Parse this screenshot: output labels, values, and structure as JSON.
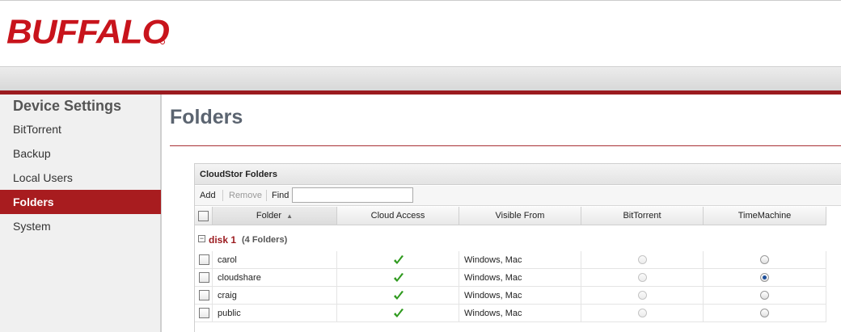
{
  "header": {
    "logo_text": "BUFFALO",
    "brand_color": "#c8141c"
  },
  "sidebar": {
    "title": "Device Settings",
    "items": [
      {
        "label": "BitTorrent",
        "active": false
      },
      {
        "label": "Backup",
        "active": false
      },
      {
        "label": "Local Users",
        "active": false
      },
      {
        "label": "Folders",
        "active": true
      },
      {
        "label": "System",
        "active": false
      }
    ]
  },
  "main": {
    "title": "Folders",
    "grid": {
      "caption": "CloudStor Folders",
      "toolbar": {
        "add": "Add",
        "remove": "Remove",
        "find_label": "Find",
        "find_value": ""
      },
      "columns": [
        "Folder",
        "Cloud Access",
        "Visible From",
        "BitTorrent",
        "TimeMachine"
      ],
      "sort_indicator": "▲",
      "group": {
        "name": "disk 1",
        "count": "(4 Folders)"
      },
      "rows": [
        {
          "folder": "carol",
          "cloud_access": "check-icon",
          "visible_from": "Windows, Mac",
          "bittorrent": false,
          "timemachine": false
        },
        {
          "folder": "cloudshare",
          "cloud_access": "check-icon",
          "visible_from": "Windows, Mac",
          "bittorrent": false,
          "timemachine": true
        },
        {
          "folder": "craig",
          "cloud_access": "check-icon",
          "visible_from": "Windows, Mac",
          "bittorrent": false,
          "timemachine": false
        },
        {
          "folder": "public",
          "cloud_access": "check-icon",
          "visible_from": "Windows, Mac",
          "bittorrent": false,
          "timemachine": false
        }
      ]
    }
  },
  "colors": {
    "accent_red": "#9b1b1f",
    "active_nav": "#a81c1f",
    "check_green": "#2f9a1e"
  }
}
